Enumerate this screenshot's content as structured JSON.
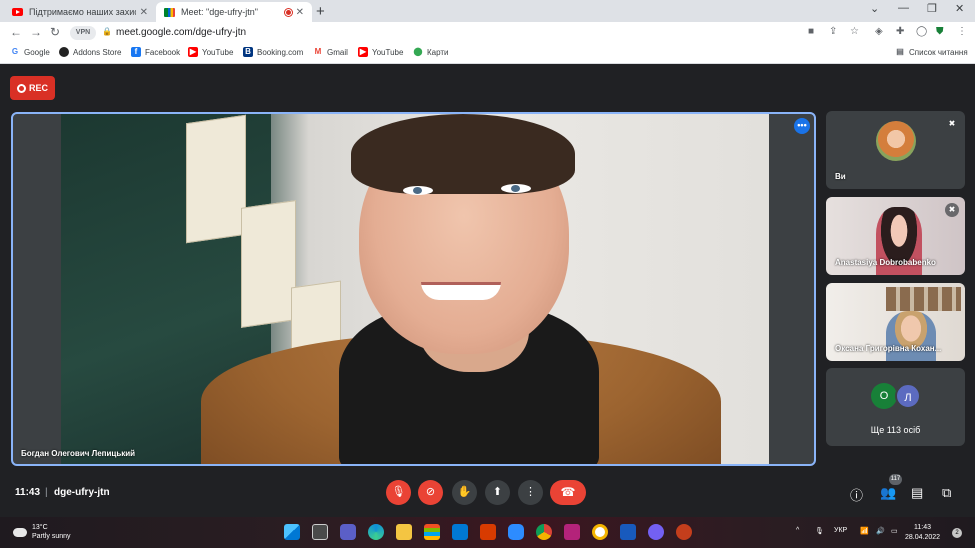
{
  "browser": {
    "tabs": [
      {
        "title": "Підтримаємо наших захисників",
        "active": false
      },
      {
        "title": "Meet: \"dge-ufry-jtn\"",
        "active": true
      }
    ],
    "new_tab": "+",
    "url": "meet.google.com/dge-ufry-jtn",
    "vpn_label": "VPN",
    "bookmarks": [
      "Google",
      "Addons Store",
      "Facebook",
      "YouTube",
      "Booking.com",
      "Gmail",
      "YouTube",
      "Карти"
    ],
    "reading_list": "Список читання"
  },
  "meet": {
    "rec_label": "REC",
    "main_speaker": "Богдан Олегович Лепицький",
    "participants": [
      {
        "name": "Ви",
        "muted": true
      },
      {
        "name": "Anastasiya Dobrobabenko",
        "muted": true
      },
      {
        "name": "Оксана Григорівна Кохан..."
      }
    ],
    "others_initials": [
      "О",
      "Л"
    ],
    "others_label": "Ще 113 осіб",
    "time": "11:43",
    "meeting_code": "dge-ufry-jtn",
    "people_count": "117"
  },
  "taskbar": {
    "temperature": "13°C",
    "weather": "Partly sunny",
    "language": "УКР",
    "time": "11:43",
    "date": "28.04.2022",
    "notifications": "2"
  },
  "colors": {
    "meet_bg": "#202124",
    "accent_red": "#ea4335",
    "focus_blue": "#8ab4f8"
  }
}
